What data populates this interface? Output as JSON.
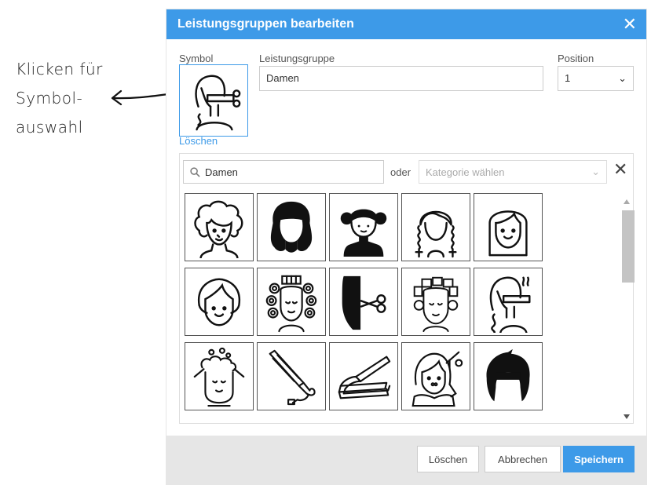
{
  "annotation": {
    "lines": [
      "Klicken für",
      "Symbol-",
      "auswahl"
    ]
  },
  "dialog": {
    "title": "Leistungsgruppen bearbeiten",
    "symbol_label": "Symbol",
    "delete_link": "Löschen",
    "group_label": "Leistungsgruppe",
    "group_value": "Damen",
    "position_label": "Position",
    "position_value": "1"
  },
  "picker": {
    "search_value": "Damen",
    "or_label": "oder",
    "category_placeholder": "Kategorie wählen",
    "icons": [
      "curly-hair-woman-icon",
      "long-hair-woman-icon",
      "bun-hair-woman-icon",
      "braids-woman-icon",
      "straight-hair-woman-icon",
      "short-hair-woman-icon",
      "curlers-woman-icon",
      "hair-cutting-icon",
      "rollers-woman-icon",
      "hair-straightening-icon",
      "hair-washing-icon",
      "flat-iron-icon",
      "hair-straightener-icon",
      "hairdresser-woman-icon",
      "bob-haircut-icon"
    ]
  },
  "footer": {
    "delete_label": "Löschen",
    "cancel_label": "Abbrechen",
    "save_label": "Speichern"
  },
  "colors": {
    "accent": "#3d9ae8",
    "footer_bg": "#e6e6e6"
  }
}
